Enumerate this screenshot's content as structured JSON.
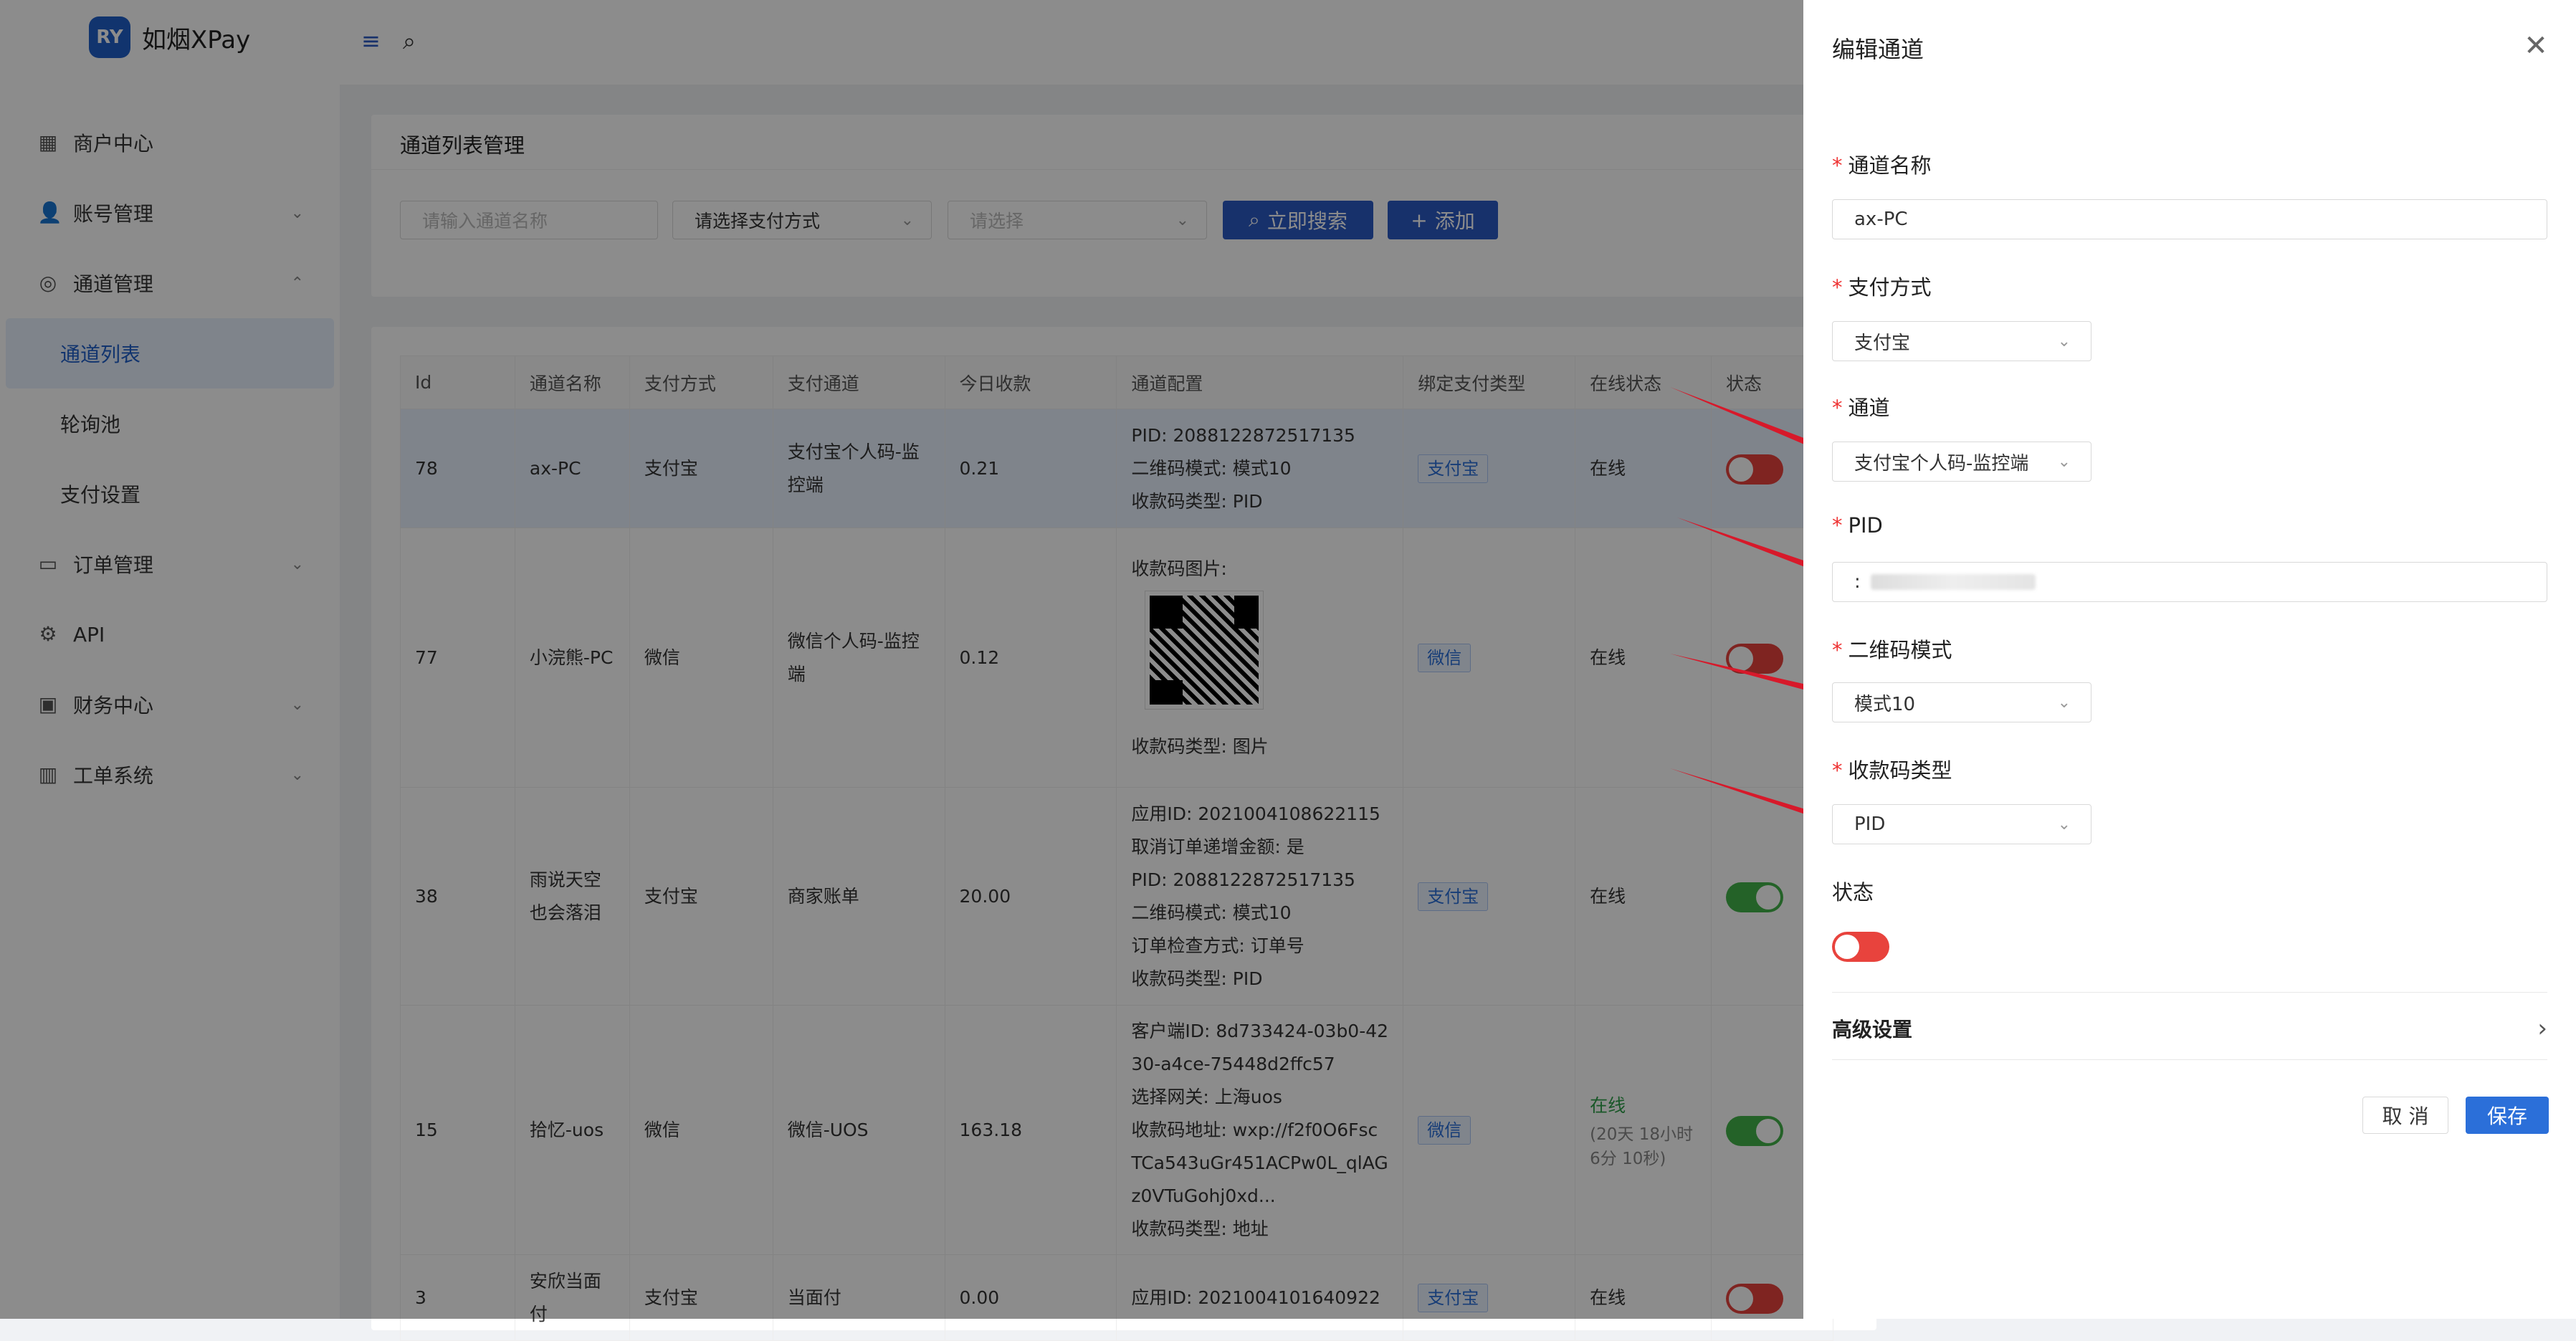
{
  "app": {
    "logo_text": "如烟XPay",
    "logo_mark": "RY"
  },
  "colors": {
    "primary": "#2b59c3",
    "online": "#2e9e4a",
    "switch_off": "#e8433d",
    "switch_on": "#43b24a"
  },
  "sidebar": {
    "items": [
      {
        "label": "商户中心",
        "icon": "grid-icon",
        "glyph": "▦"
      },
      {
        "label": "账号管理",
        "icon": "user-icon",
        "glyph": "👤",
        "chevron": "⌄"
      },
      {
        "label": "通道管理",
        "icon": "channel-icon",
        "glyph": "◎",
        "chevron": "⌃"
      },
      {
        "label": "订单管理",
        "icon": "order-icon",
        "glyph": "▭",
        "chevron": "⌄"
      },
      {
        "label": "API",
        "icon": "api-icon",
        "glyph": "⚙"
      },
      {
        "label": "财务中心",
        "icon": "finance-icon",
        "glyph": "▣",
        "chevron": "⌄"
      },
      {
        "label": "工单系统",
        "icon": "ticket-icon",
        "glyph": "▥",
        "chevron": "⌄"
      }
    ],
    "sub_items": [
      "通道列表",
      "轮询池",
      "支付设置"
    ]
  },
  "topbar": {
    "menu_glyph": "≡",
    "search_glyph": "⌕"
  },
  "filter": {
    "title": "通道列表管理",
    "name_placeholder": "请输入通道名称",
    "pay_method_placeholder": "请选择支付方式",
    "select_placeholder": "请选择",
    "search_button": "立即搜索",
    "add_button": "添加",
    "search_glyph": "⌕",
    "add_glyph": "+",
    "arrow_glyph": "⌄"
  },
  "table": {
    "headers": [
      "Id",
      "通道名称",
      "支付方式",
      "支付通道",
      "今日收款",
      "通道配置",
      "绑定支付类型",
      "在线状态",
      "状态"
    ],
    "rows": [
      {
        "id": "78",
        "name": "ax-PC",
        "method": "支付宝",
        "channel": "支付宝个人码-监控端",
        "today": "0.21",
        "config": [
          "PID: 2088122872517135",
          "二维码模式: 模式10",
          "收款码类型: PID"
        ],
        "bind": "支付宝",
        "online": "在线",
        "online_sub": "",
        "status": "off"
      },
      {
        "id": "77",
        "name": "小浣熊-PC",
        "method": "微信",
        "channel": "微信个人码-监控端",
        "today": "0.12",
        "config_qr_label": "收款码图片:",
        "config": [
          "收款码类型: 图片"
        ],
        "bind": "微信",
        "online": "在线",
        "online_sub": "",
        "status": "off"
      },
      {
        "id": "38",
        "name": "雨说天空也会落泪",
        "method": "支付宝",
        "channel": "商家账单",
        "today": "20.00",
        "config": [
          "应用ID: 2021004108622115",
          "取消订单递增金额: 是",
          "PID: 2088122872517135",
          "二维码模式: 模式10",
          "订单检查方式: 订单号",
          "收款码类型: PID"
        ],
        "bind": "支付宝",
        "online": "在线",
        "online_sub": "",
        "status": "on"
      },
      {
        "id": "15",
        "name": "拾忆-uos",
        "method": "微信",
        "channel": "微信-UOS",
        "today": "163.18",
        "config": [
          "客户端ID: 8d733424-03b0-4230-a4ce-75448d2ffc57",
          "选择网关: 上海uos",
          "收款码地址: wxp://f2f0O6FscTCa543uGr451ACPw0L_qlAGz0VTuGohj0xd...",
          "收款码类型: 地址"
        ],
        "bind": "微信",
        "online": "在线",
        "online_sub": "(20天 18小时 6分 10秒)",
        "status": "on"
      },
      {
        "id": "3",
        "name": "安欣当面付",
        "method": "支付宝",
        "channel": "当面付",
        "today": "0.00",
        "config": [
          "应用ID: 2021004101640922"
        ],
        "bind": "支付宝",
        "online": "在线",
        "online_sub": "",
        "status": "off"
      }
    ]
  },
  "drawer": {
    "title": "编辑通道",
    "close_glyph": "✕",
    "fields": {
      "name": {
        "label": "通道名称",
        "value": "ax-PC"
      },
      "pay_method": {
        "label": "支付方式",
        "value": "支付宝"
      },
      "channel": {
        "label": "通道",
        "value": "支付宝个人码-监控端"
      },
      "pid": {
        "label": "PID",
        "value": ":"
      },
      "qr_mode": {
        "label": "二维码模式",
        "value": "模式10"
      },
      "code_type": {
        "label": "收款码类型",
        "value": "PID"
      },
      "status": {
        "label": "状态"
      }
    },
    "required_mark": "*",
    "advanced": "高级设置",
    "advanced_glyph": "›",
    "cancel": "取 消",
    "save": "保存"
  }
}
